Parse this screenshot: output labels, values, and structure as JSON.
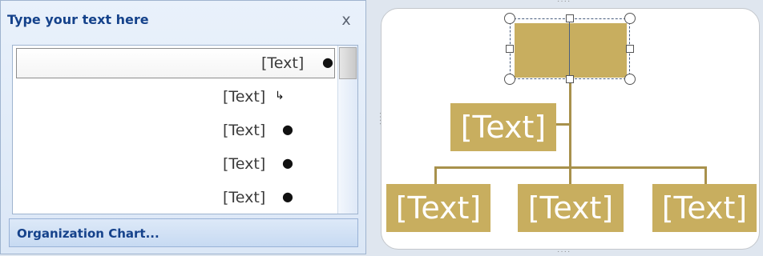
{
  "text_pane": {
    "title": "Type your text here",
    "close_label": "x",
    "items": [
      {
        "text": "[Text]",
        "marker": "●"
      },
      {
        "text": "[Text]",
        "marker": "↳"
      },
      {
        "text": "[Text]",
        "marker": "●"
      },
      {
        "text": "[Text]",
        "marker": "●"
      },
      {
        "text": "[Text]",
        "marker": "●"
      }
    ],
    "footer_link": "Organization Chart..."
  },
  "diagram": {
    "assistant": "[Text]",
    "children": [
      "[Text]",
      "[Text]",
      "[Text]"
    ],
    "colors": {
      "box": "#c8ae5f",
      "connector": "#a8914c",
      "box_text": "#ffffff"
    }
  }
}
